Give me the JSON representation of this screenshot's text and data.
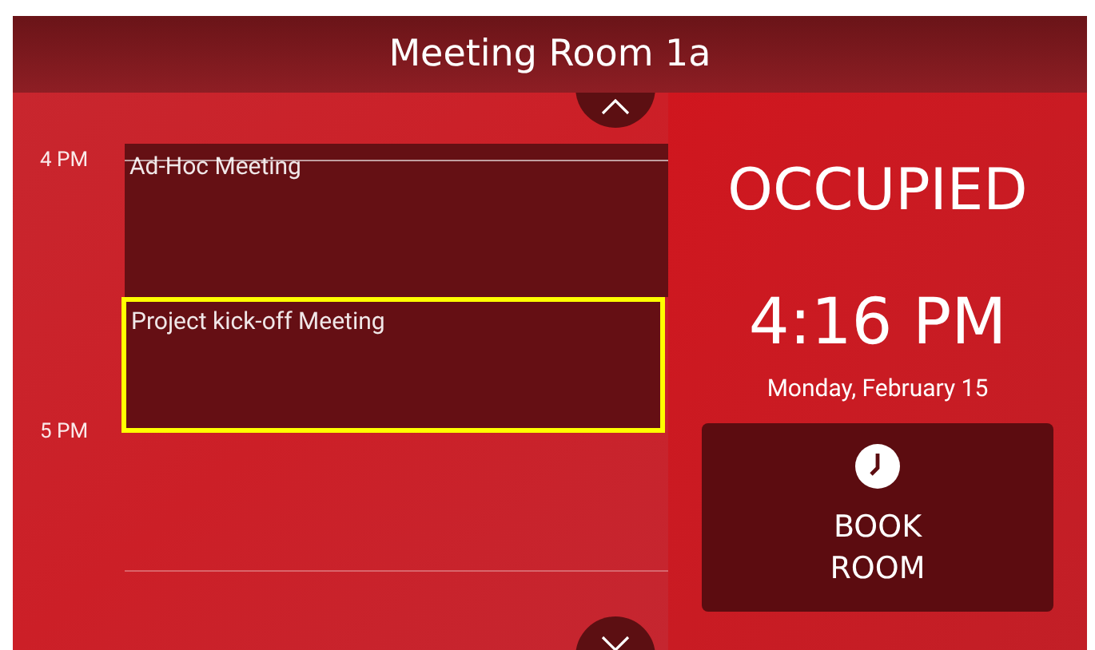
{
  "header": {
    "title": "Meeting Room 1a"
  },
  "timeline": {
    "hours": [
      {
        "label": "4 PM"
      },
      {
        "label": "5 PM"
      }
    ],
    "events": [
      {
        "title": "Ad-Hoc Meeting",
        "selected": false
      },
      {
        "title": "Project kick-off Meeting",
        "selected": true
      }
    ]
  },
  "status": {
    "label": "OCCUPIED",
    "time": "4:16 PM",
    "date": "Monday, February 15"
  },
  "book_button": {
    "label": "BOOK ROOM"
  }
}
